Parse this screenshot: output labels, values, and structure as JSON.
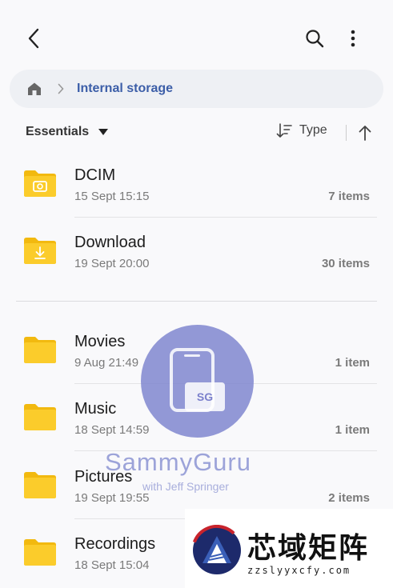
{
  "header": {
    "back_icon": "arrow-left-icon",
    "search_icon": "search-icon",
    "more_icon": "more-vertical-icon"
  },
  "breadcrumb": {
    "home_icon": "home-icon",
    "current": "Internal storage"
  },
  "sort": {
    "filter_label": "Essentials",
    "sort_label": "Type"
  },
  "folders": [
    {
      "name": "DCIM",
      "date": "15 Sept 15:15",
      "count": "7 items",
      "icon": "camera-folder-icon"
    },
    {
      "name": "Download",
      "date": "19 Sept 20:00",
      "count": "30 items",
      "icon": "download-folder-icon"
    },
    {
      "name": "Movies",
      "date": "9 Aug 21:49",
      "count": "1 item",
      "icon": "folder-icon"
    },
    {
      "name": "Music",
      "date": "18 Sept 14:59",
      "count": "1 item",
      "icon": "folder-icon"
    },
    {
      "name": "Pictures",
      "date": "19 Sept 19:55",
      "count": "2 items",
      "icon": "folder-icon"
    },
    {
      "name": "Recordings",
      "date": "18 Sept 15:04",
      "count": "",
      "icon": "folder-icon"
    }
  ],
  "watermark": {
    "brand": "SammyGuru",
    "sub": "with Jeff Springer",
    "badge": "SG"
  },
  "corner_badge": {
    "title": "芯域矩阵",
    "url": "zzslyyxcfy.com"
  },
  "colors": {
    "accent": "#3c5ea8",
    "folder": "#f9c51c",
    "background": "#f9f9fb"
  }
}
